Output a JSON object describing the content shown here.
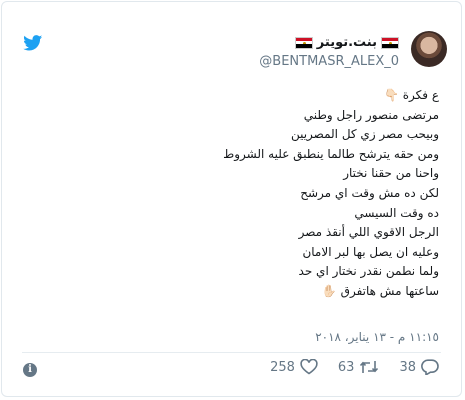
{
  "colors": {
    "twitter_blue": "#1da1f2",
    "text": "#14171a",
    "muted": "#657786",
    "border": "#e1e8ed"
  },
  "header": {
    "display_name": "بنت.تويتر",
    "handle": "@BENTMASR_ALEX_0",
    "flag_icon": "egypt-flag",
    "logo_icon": "twitter-bird"
  },
  "tweet": {
    "lines": [
      "ع فكرة 👇🏻",
      "مرتضى منصور راجل وطني",
      "وبيحب مصر زي كل المصريين",
      "ومن حقه يترشح طالما ينطبق عليه الشروط",
      "واحنا من حقنا نختار",
      "لكن ده مش وقت اي مرشح",
      "ده وقت السيسي",
      "الرجل الاقوي اللي أنقذ مصر",
      "وعليه ان يصل بها لبر الامان",
      "ولما نطمن نقدر نختار اي حد",
      "ساعتها مش هاتفرق ✋🏻"
    ],
    "timestamp": "١١:١٥ م - ١٣ يناير، ٢٠١٨"
  },
  "actions": {
    "replies": "38",
    "retweets": "63",
    "likes": "258"
  }
}
